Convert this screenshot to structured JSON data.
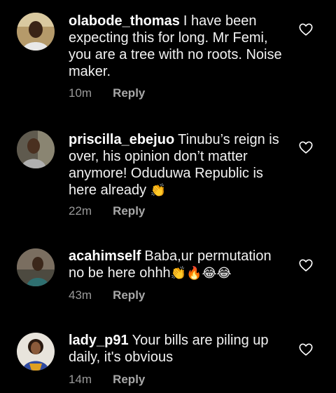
{
  "comments": [
    {
      "username": "olabode_thomas",
      "text": "I have been expecting this for long. Mr Femi, you are a tree with no roots. Noise maker.",
      "emojis": "",
      "time": "10m",
      "reply_label": "Reply",
      "heart_icon": "heart-outline-icon"
    },
    {
      "username": "priscilla_ebejuo",
      "text": "Tinubu’s reign is over, his opinion don’t matter anymore! Oduduwa Republic is here already",
      "emojis": "👏",
      "time": "22m",
      "reply_label": "Reply",
      "heart_icon": "heart-outline-icon"
    },
    {
      "username": "acahimself",
      "text": "Baba,ur permutation no be here ohhh",
      "emojis": "👏🔥😂😂",
      "time": "43m",
      "reply_label": "Reply",
      "heart_icon": "heart-outline-icon"
    },
    {
      "username": "lady_p91",
      "text": "Your bills are piling up daily, it's obvious",
      "emojis": "",
      "time": "14m",
      "reply_label": "Reply",
      "heart_icon": "heart-outline-icon"
    }
  ]
}
